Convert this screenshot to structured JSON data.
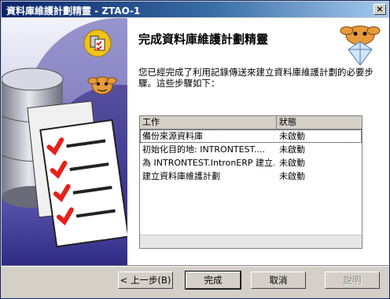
{
  "window": {
    "title": "資料庫維護計劃精靈 - ZTAO-1"
  },
  "page": {
    "heading": "完成資料庫維護計劃精靈",
    "description": "您已經完成了利用記錄傳送來建立資料庫維護計劃的必要步驟。這些步驟如下："
  },
  "table": {
    "columns": [
      "工作",
      "狀態"
    ],
    "rows": [
      {
        "task": "備份來源資料庫",
        "status": "未啟動"
      },
      {
        "task": "初始化目的地: INTRONTEST....",
        "status": "未啟動"
      },
      {
        "task": "為 INTRONTEST.IntronERP 建立...",
        "status": "未啟動"
      },
      {
        "task": "建立資料庫維護計劃",
        "status": "未啟動"
      }
    ]
  },
  "buttons": {
    "back": "< 上一步(B)",
    "finish": "完成",
    "cancel": "取消",
    "help": "說明"
  },
  "colors": {
    "accent": "#0a246a",
    "panel": "#3b3594",
    "check": "#e8201a"
  }
}
